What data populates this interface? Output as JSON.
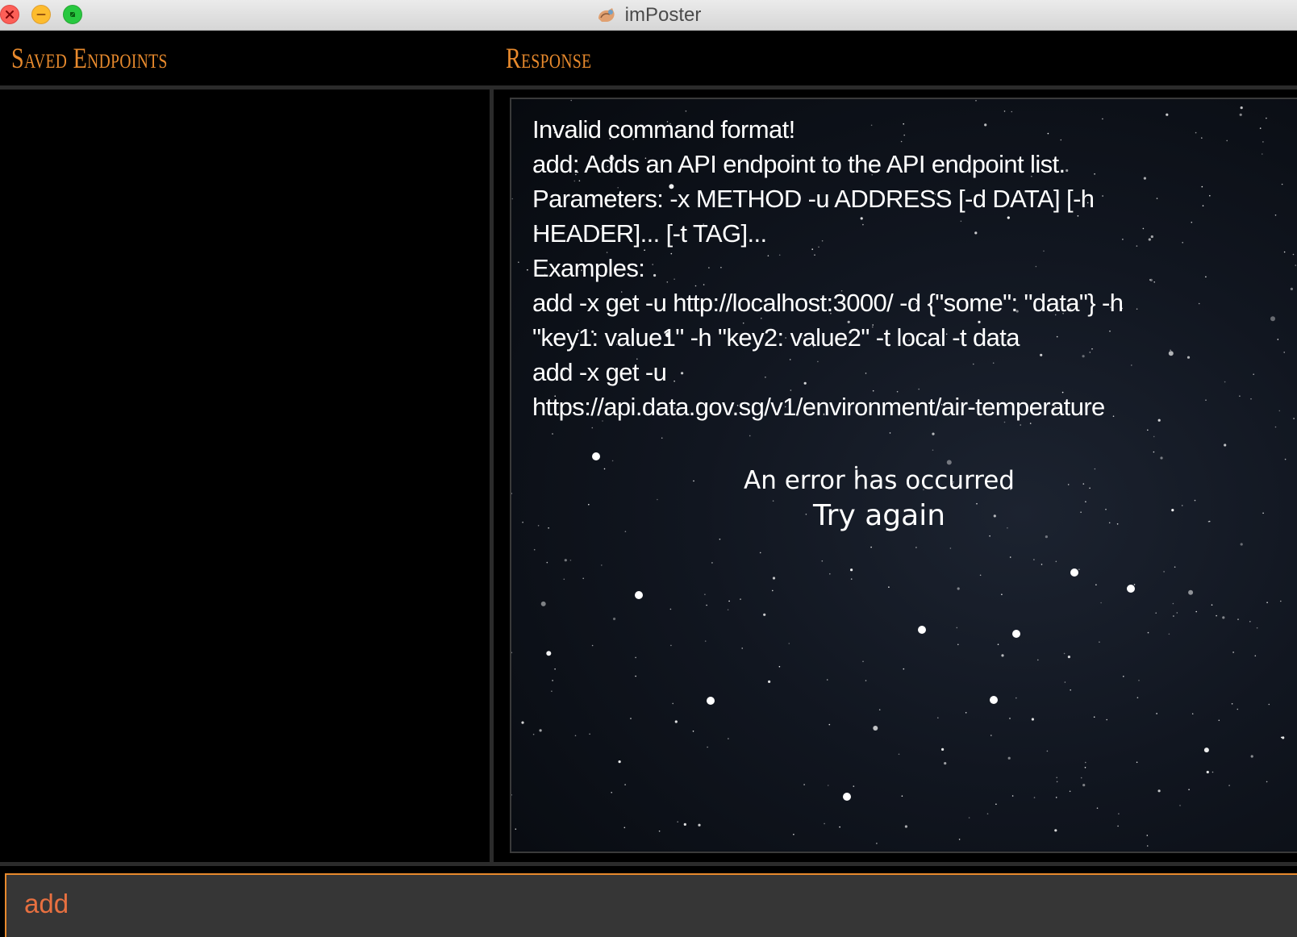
{
  "window": {
    "title": "imPoster",
    "controls": [
      "close-icon",
      "minimize-icon",
      "maximize-icon"
    ]
  },
  "saved_endpoints": {
    "header": "Saved Endpoints",
    "items": []
  },
  "response": {
    "header": "Response",
    "lines": [
      "Invalid command format!",
      "add: Adds an API endpoint to the API endpoint list.",
      "Parameters: -x METHOD -u ADDRESS [-d DATA] [-h",
      "HEADER]... [-t TAG]...",
      "Examples:",
      "add -x get -u http://localhost:3000/ -d {\"some\": \"data\"} -h",
      "\"key1: value1\" -h \"key2: value2\" -t local -t data",
      "add -x get -u",
      "https://api.data.gov.sg/v1/environment/air-temperature"
    ],
    "error_image": {
      "line1": "An error has occurred",
      "line2": "Try again"
    }
  },
  "command_box": {
    "value": "add"
  },
  "colors": {
    "accent": "#e88a2d",
    "command_text": "#e87040",
    "background": "#000000",
    "input_background": "#363636"
  }
}
